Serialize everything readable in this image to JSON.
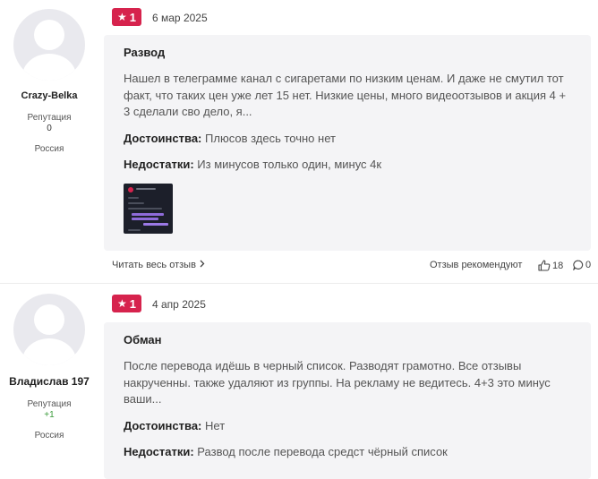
{
  "reviews": [
    {
      "author": "Crazy-Belka",
      "reputation_label": "Репутация",
      "reputation": "0",
      "country": "Россия",
      "rating": "1",
      "date": "6 мар 2025",
      "title": "Развод",
      "text": "Нашел в телеграмме канал с сигаретами по низким ценам. И даже не смутил тот факт, что таких цен уже лет 15 нет. Низкие цены, много видеоотзывов и акция 4 + 3 сделали сво дело, я...",
      "pros_label": "Достоинства:",
      "pros": "Плюсов здесь точно нет",
      "cons_label": "Недостатки:",
      "cons": "Из минусов только один, минус 4к",
      "read_more": "Читать весь отзыв",
      "recommend_label": "Отзыв рекомендуют",
      "likes": "18",
      "comments": "0"
    },
    {
      "author": "Владислав 197",
      "reputation_label": "Репутация",
      "reputation": "+1",
      "country": "Россия",
      "rating": "1",
      "date": "4 апр 2025",
      "title": "Обман",
      "text": "После перевода идёшь в черный список. Разводят грамотно. Все отзывы накрученны. также удаляют из группы. На рекламу не ведитесь. 4+3 это минус ваши...",
      "pros_label": "Достоинства:",
      "pros": "Нет",
      "cons_label": "Недостатки:",
      "cons": "Развод после перевода средст чёрный список"
    }
  ],
  "colors": {
    "badge": "#d6234d",
    "card_bg": "#f4f4f6",
    "positive": "#3a9a3a"
  },
  "icons": {
    "rating": "star-icon",
    "read_more": "chevron-right-icon",
    "likes": "thumbs-up-icon",
    "comments": "comment-icon"
  }
}
